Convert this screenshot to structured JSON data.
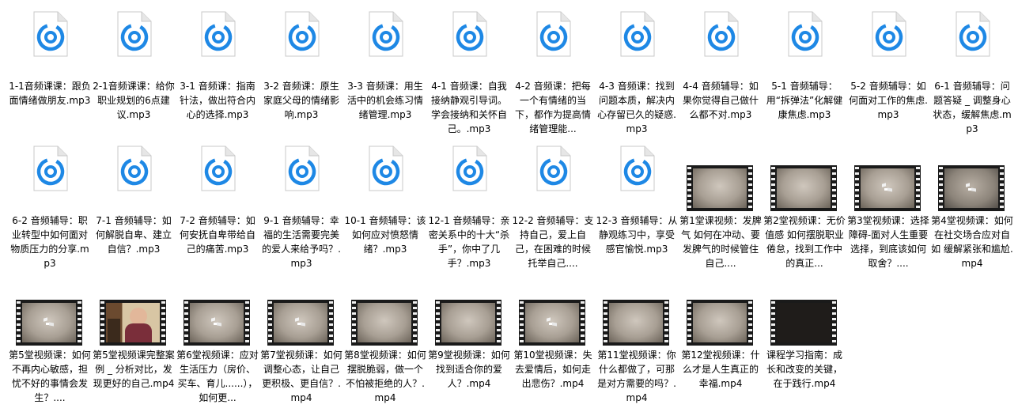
{
  "files": [
    {
      "kind": "audio",
      "label": "1-1音频课课：跟负面情绪做朋友.mp3"
    },
    {
      "kind": "audio",
      "label": "2-1音频课课：给你职业规划的6点建议.mp3"
    },
    {
      "kind": "audio",
      "label": "3-1 音频课：指南针法，做出符合内心的选择.mp3"
    },
    {
      "kind": "audio",
      "label": "3-2 音频课：原生家庭父母的情绪影响.mp3"
    },
    {
      "kind": "audio",
      "label": "3-3 音频课：用生活中的机会练习情绪管理.mp3"
    },
    {
      "kind": "audio",
      "label": "4-1 音频课：自我接纳静观引导词。学会接纳和关怀自己。.mp3"
    },
    {
      "kind": "audio",
      "label": "4-2 音频课：把每一个有情绪的当下，都作为提高情绪管理能..."
    },
    {
      "kind": "audio",
      "label": "4-3 音频课：找到问题本质，解决内心存留已久的疑惑.mp3"
    },
    {
      "kind": "audio",
      "label": "4-4 音频辅导：如果你觉得自己做什么都不对.mp3"
    },
    {
      "kind": "audio",
      "label": "5-1 音频辅导：用“拆弹法”化解健康焦虑.mp3"
    },
    {
      "kind": "audio",
      "label": "5-2 音频辅导：如何面对工作的焦虑.mp3"
    },
    {
      "kind": "audio",
      "label": "6-1 音频辅导：问题答疑 _ 调整身心状态，缓解焦虑.mp3"
    },
    {
      "kind": "audio",
      "label": "6-2 音频辅导：职业转型中如何面对物质压力的分享.mp3"
    },
    {
      "kind": "audio",
      "label": "7-1 音频辅导：如何解脱自卑、建立自信？.mp3"
    },
    {
      "kind": "audio",
      "label": "7-2 音频辅导：如何安抚自卑带给自己的痛苦.mp3"
    },
    {
      "kind": "audio",
      "label": "9-1 音频辅导：幸福的生活需要完美的爱人来给予吗？.mp3"
    },
    {
      "kind": "audio",
      "label": "10-1 音频辅导：该如何应对愤怒情绪？.mp3"
    },
    {
      "kind": "audio",
      "label": "12-1 音频辅导：亲密关系中的十大“杀手”，你中了几手？.mp3"
    },
    {
      "kind": "audio",
      "label": "12-2 音频辅导：支持自己，爱上自己，在困难的时候托举自己...."
    },
    {
      "kind": "audio",
      "label": "12-3 音频辅导：从静观练习中，享受感官愉悦.mp3"
    },
    {
      "kind": "video",
      "frame": "plain",
      "label": "第1堂课视频：发脾气 如何在冲动、要发脾气的时候管住自己...."
    },
    {
      "kind": "video",
      "frame": "plain",
      "label": "第2堂视频课：无价值感 如何摆脱职业倦怠，找到工作中的真正..."
    },
    {
      "kind": "video",
      "frame": "logo",
      "label": "第3堂视频课：选择障碍-面对人生重要选择，到底该如何取舍？...."
    },
    {
      "kind": "video",
      "frame": "logo2",
      "label": "第4堂视频课：如何在社交场合应对自如 缓解紧张和尴尬.mp4"
    },
    {
      "kind": "video",
      "frame": "logo",
      "label": "第5堂视频课：如何不再内心敏感，担忧不好的事情会发生？...."
    },
    {
      "kind": "video",
      "frame": "photo",
      "label": "第5堂视频课完整案例 _ 分析对比，发现更好的自己.mp4"
    },
    {
      "kind": "video",
      "frame": "logo",
      "label": "第6堂视频课：应对生活压力（房价、买车、育儿......），如何更..."
    },
    {
      "kind": "video",
      "frame": "logo",
      "label": "第7堂视频课：如何调整心态，让自己更积极、更自信？.mp4"
    },
    {
      "kind": "video",
      "frame": "plain",
      "label": "第8堂视频课：如何摆脱脆弱，做一个不怕被拒绝的人？.mp4"
    },
    {
      "kind": "video",
      "frame": "plain",
      "label": "第9堂视频课：如何找到适合你的爱人？.mp4"
    },
    {
      "kind": "video",
      "frame": "logo",
      "label": "第10堂视频课：失去爱情后，如何走出悲伤？.mp4"
    },
    {
      "kind": "video",
      "frame": "plain",
      "label": "第11堂视频课：你什么都做了，可那是对方需要的吗？.mp4"
    },
    {
      "kind": "video",
      "frame": "plain",
      "label": "第12堂视频课：什么才是人生真正的幸福.mp4"
    },
    {
      "kind": "video",
      "frame": "black",
      "label": "课程学习指南：成长和改变的关键，在于践行.mp4"
    }
  ],
  "colors": {
    "audio_icon": "#1e88e5",
    "doc_bg": "#ffffff",
    "doc_fold": "#e6e6e6"
  }
}
